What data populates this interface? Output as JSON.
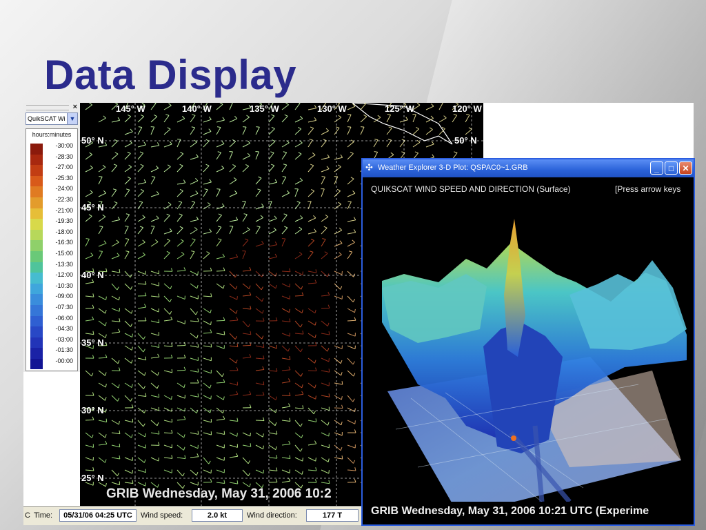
{
  "slide": {
    "title": "Data Display"
  },
  "left_panel": {
    "close_glyph": "×",
    "dataset_combo": "QuikSCAT Wi",
    "legend_title": "hours:minutes",
    "legend_labels": [
      "-30:00",
      "-28:30",
      "-27:00",
      "-25:30",
      "-24:00",
      "-22:30",
      "-21:00",
      "-19:30",
      "-18:00",
      "-16:30",
      "-15:00",
      "-13:30",
      "-12:00",
      "-10:30",
      "-09:00",
      "-07:30",
      "-06:00",
      "-04:30",
      "-03:00",
      "-01:30",
      "-00:00"
    ],
    "legend_colors": [
      "#8b1a0c",
      "#a8280f",
      "#c23d13",
      "#d85a1a",
      "#e07b22",
      "#e39c2c",
      "#e6be38",
      "#d8d94a",
      "#b7d85a",
      "#8fd06a",
      "#6ac978",
      "#4fc49b",
      "#46bccf",
      "#3fa6dc",
      "#3a8ddc",
      "#3576d8",
      "#2f5fd2",
      "#2848c6",
      "#2234b8",
      "#1a22a6",
      "#121494"
    ]
  },
  "map": {
    "lon_labels": [
      "145° W",
      "140° W",
      "135° W",
      "130° W",
      "125° W",
      "120° W"
    ],
    "lat_labels": [
      "50° N",
      "45° N",
      "40° N",
      "35° N",
      "30° N",
      "25° N"
    ],
    "caption": "GRIB Wednesday, May 31, 2006 10:2"
  },
  "statusbar": {
    "time_label": "Time:",
    "time_value": "05/31/06 04:25 UTC",
    "speed_label": "Wind speed:",
    "speed_value": "2.0 kt",
    "direction_label": "Wind direction:",
    "direction_value": "177 T"
  },
  "plot_window": {
    "title": "Weather Explorer 3-D Plot: QSPAC0~1.GRB",
    "header": "QUIKSCAT WIND SPEED AND DIRECTION (Surface)",
    "hint": "[Press arrow keys",
    "caption": "GRIB Wednesday, May 31, 2006 10:21 UTC (Experime",
    "btn_minimize": "_",
    "btn_maximize": "□",
    "btn_close": "✕"
  }
}
